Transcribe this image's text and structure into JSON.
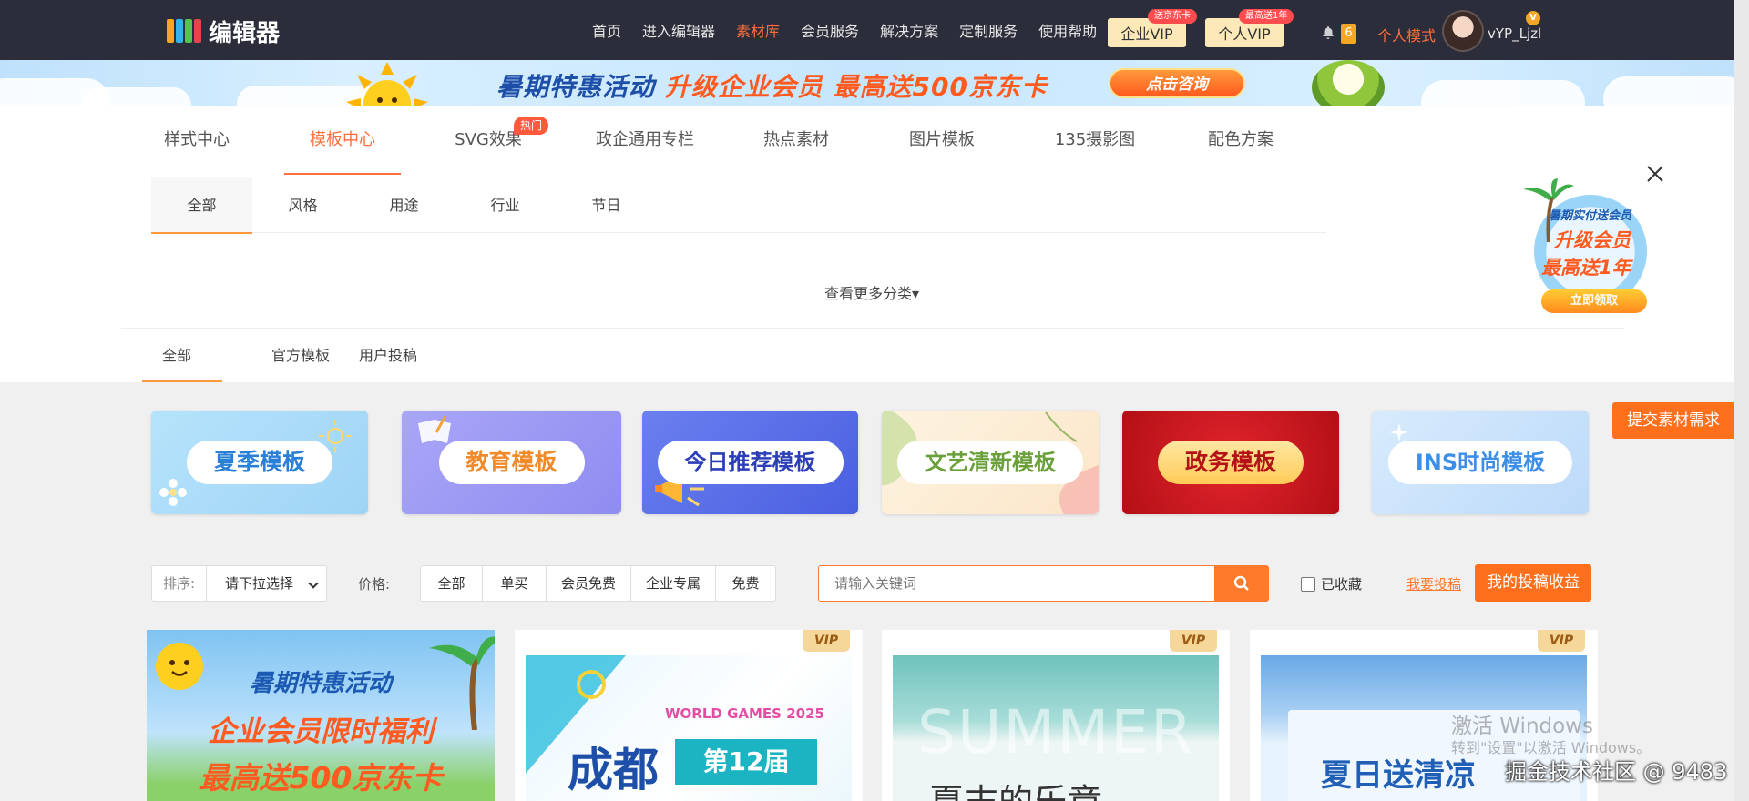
{
  "brand": {
    "logo_mark": "135",
    "logo_text": "编辑器"
  },
  "nav": {
    "items": [
      {
        "label": "首页",
        "active": false
      },
      {
        "label": "进入编辑器",
        "active": false
      },
      {
        "label": "素材库",
        "active": true
      },
      {
        "label": "会员服务",
        "active": false
      },
      {
        "label": "解决方案",
        "active": false
      },
      {
        "label": "定制服务",
        "active": false
      },
      {
        "label": "使用帮助",
        "active": false
      }
    ],
    "enterprise_vip": {
      "label": "企业VIP",
      "tag": "送京东卡"
    },
    "personal_vip": {
      "label": "个人VIP",
      "tag": "最高送1年"
    },
    "notification_count": "6",
    "mode": "个人模式",
    "avatar_badge": "V",
    "username": "vYP_Ljzl"
  },
  "promo": {
    "text_a": "暑期特惠活动 ",
    "text_b": "升级企业会员 最高送500京东卡",
    "button": "点击咨询"
  },
  "tabs": [
    {
      "label": "样式中心",
      "active": false
    },
    {
      "label": "模板中心",
      "active": true
    },
    {
      "label": "SVG效果",
      "active": false,
      "tag": "热门"
    },
    {
      "label": "政企通用专栏",
      "active": false
    },
    {
      "label": "热点素材",
      "active": false
    },
    {
      "label": "图片模板",
      "active": false
    },
    {
      "label": "135摄影图",
      "active": false
    },
    {
      "label": "配色方案",
      "active": false
    }
  ],
  "subtabs": [
    {
      "label": "全部",
      "active": true
    },
    {
      "label": "风格",
      "active": false
    },
    {
      "label": "用途",
      "active": false
    },
    {
      "label": "行业",
      "active": false
    },
    {
      "label": "节日",
      "active": false
    }
  ],
  "more_categories": "查看更多分类▾",
  "source_tabs": [
    {
      "label": "全部",
      "active": true
    },
    {
      "label": "官方模板",
      "active": false
    },
    {
      "label": "用户投稿",
      "active": false
    }
  ],
  "side_badge": {
    "line1": "暑期实付送会员",
    "line2": "升级会员",
    "line3": "最高送1年",
    "button": "立即领取"
  },
  "submit_request": "提交素材需求",
  "categories": [
    {
      "label": "夏季模板",
      "bg": "#a9dcf8",
      "pill_color": "#2a7fd6"
    },
    {
      "label": "教育模板",
      "bg": "#9e9cf5",
      "pill_color": "#f08a2a"
    },
    {
      "label": "今日推荐模板",
      "bg": "#5a6fe6",
      "pill_color": "#2c3fb8"
    },
    {
      "label": "文艺清新模板",
      "bg": "#fbeed6",
      "pill_color": "#6aa03a"
    },
    {
      "label": "政务模板",
      "bg": "#c8141c",
      "pill_color": "#b51218"
    },
    {
      "label": "INS时尚模板",
      "bg": "#cde4fb",
      "pill_color": "#3d8ee6"
    }
  ],
  "filters": {
    "sort_label": "排序:",
    "sort_value": "请下拉选择",
    "price_label": "价格:",
    "price_options": [
      "全部",
      "单买",
      "会员免费",
      "企业专属",
      "免费"
    ],
    "search_placeholder": "请输入关键词",
    "favorites": "已收藏",
    "contribute": "我要投稿",
    "earnings": "我的投稿收益"
  },
  "templates": [
    {
      "vip": "",
      "line1": "暑期特惠活动",
      "line2": "企业会员限时福利",
      "line3": "最高送500京东卡"
    },
    {
      "vip": "VIP",
      "en": "WORLD GAMES 2025",
      "city": "成都",
      "edition": "第12届"
    },
    {
      "vip": "VIP",
      "en": "SUMMER",
      "title": "夏末的乐章"
    },
    {
      "vip": "VIP",
      "title": "夏日送清凉"
    }
  ],
  "watermarks": {
    "activate": "激活 Windows",
    "activate_sub": "转到\"设置\"以激活 Windows。",
    "site": "掘金技术社区 @ 9483"
  },
  "colors": {
    "nav_bg": "#2b2d3a",
    "accent": "#ff6f3c",
    "cta": "#ff6f1c"
  }
}
